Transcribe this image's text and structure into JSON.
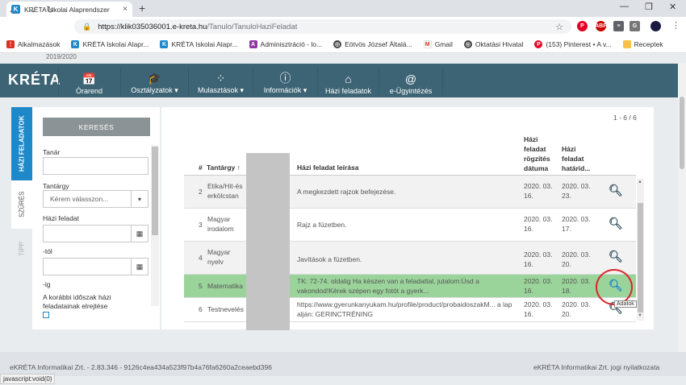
{
  "browser": {
    "tab_title": "KRÉTA Iskolai Alaprendszer",
    "tab_close": "×",
    "new_tab": "+",
    "url_domain": "https://klik035036001.e-kreta.hu",
    "url_path": "/Tanulo/TanuloHaziFeladat",
    "bookmarks": [
      {
        "label": "Alkalmazások",
        "icon": "apps-grid-icon"
      },
      {
        "label": "KRÉTA Iskolai Alapr...",
        "icon": "kreta-icon"
      },
      {
        "label": "KRÉTA Iskolai Alapr...",
        "icon": "kreta-icon"
      },
      {
        "label": "Adminisztráció - lo...",
        "icon": "admin-icon"
      },
      {
        "label": "Eötvös József Általá...",
        "icon": "globe-icon"
      },
      {
        "label": "Gmail",
        "icon": "gmail-icon"
      },
      {
        "label": "Oktatási Hivatal",
        "icon": "globe-icon"
      },
      {
        "label": "(153) Pinterest • A v...",
        "icon": "pinterest-icon"
      },
      {
        "label": "Receptek",
        "icon": "folder-icon"
      }
    ]
  },
  "header": {
    "year_text": "2019/2020",
    "logo": "KRÉTA",
    "nav": [
      {
        "label": "Órarend",
        "icon": "calendar-icon"
      },
      {
        "label": "Osztályzatok ▾",
        "icon": "graduation-cap-icon"
      },
      {
        "label": "Mulasztások ▾",
        "icon": "spinner-icon"
      },
      {
        "label": "Információk ▾",
        "icon": "info-icon"
      },
      {
        "label": "Házi feladatok",
        "icon": "home-icon"
      },
      {
        "label": "e-Ügyintézés",
        "icon": "at-icon"
      }
    ]
  },
  "sidebar": {
    "tabs": [
      "HÁZI FELADATOK",
      "SZŰRÉS",
      "TIPP"
    ],
    "search_button": "KERESÉS",
    "teacher_label": "Tanár",
    "subject_label": "Tantárgy",
    "subject_placeholder": "Kérem válasszon...",
    "homework_label": "Házi feladat",
    "from_label": "-tól",
    "to_label": "-ig",
    "hide_earlier_label": "A korábbi időszak házi feladatainak elrejtése"
  },
  "table": {
    "pager": "1 - 6 / 6",
    "columns": {
      "num": "#",
      "subject": "Tantárgy",
      "description": "Házi feladat leírása",
      "recorded": "Házi feladat rögzítés dátuma",
      "deadline": "Házi feladat határid..."
    },
    "rows": [
      {
        "num": "2",
        "subject": "Etika/Hit-és erkölcstan",
        "description": "A megkezdett rajzok befejezése.",
        "recorded": "2020. 03. 16.",
        "deadline": "2020. 03. 23."
      },
      {
        "num": "3",
        "subject": "Magyar irodalom",
        "description": "Rajz a füzetben.",
        "recorded": "2020. 03. 16.",
        "deadline": "2020. 03. 17."
      },
      {
        "num": "4",
        "subject": "Magyar nyelv",
        "description": "Javítások a füzetben.",
        "recorded": "2020. 03. 16.",
        "deadline": "2020. 03. 20."
      },
      {
        "num": "5",
        "subject": "Matematika",
        "description": "TK: 72-74. oldalig Ha készen van a feladattal, jutalom:Úsd a vakondod!Kérek szépen egy fotót a gyerk...",
        "recorded": "2020. 03. 16.",
        "deadline": "2020. 03. 18."
      },
      {
        "num": "6",
        "subject": "Testnevelés",
        "description": "https://www.gyerunkanyukam.hu/profile/product/probaidoszakM... a lap alján: GERINCTRÉNING",
        "recorded": "2020. 03. 16.",
        "deadline": "2020. 03. 20."
      }
    ],
    "selected_row": 3,
    "tooltip": "Adatok"
  },
  "footer": {
    "left": "eKRÉTA Informatikai Zrt. - 2.83.346 - 9126c4ea434a523f97b4a76fa6260a2ceaebd396",
    "right": "eKRÉTA Informatikai Zrt. jogi nyilatkozata"
  },
  "status_bar": "javascript:void(0)",
  "colors": {
    "nav_bg": "#3d6474",
    "selected_row": "#9bd49b",
    "accent_tab": "#1e88c8",
    "highlight_circle": "#d9262c"
  }
}
